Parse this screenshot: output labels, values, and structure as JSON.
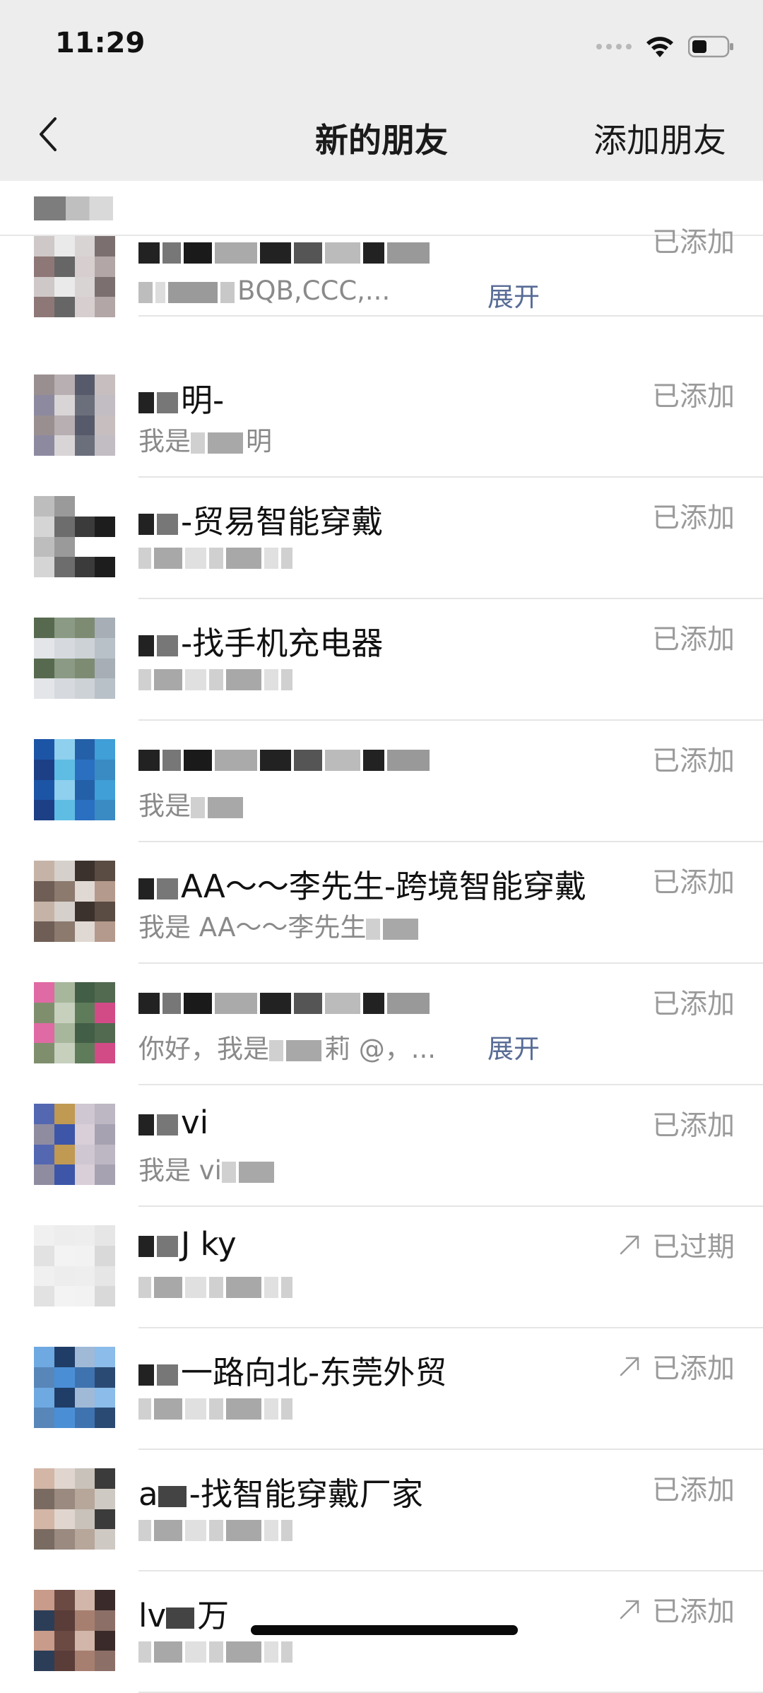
{
  "status_bar": {
    "time": "11:29"
  },
  "nav": {
    "back_icon": "chevron-left-icon",
    "title": "新的朋友",
    "right_action": "添加朋友"
  },
  "rows": [
    {
      "name": "",
      "message": "BQB,CCC,...",
      "expand": "展开",
      "status": "已添加",
      "arrow": false,
      "avatar": [
        "#cfc8c8",
        "#7b6f70",
        "#d7cfcf",
        "#eaeaea",
        "#8e7777",
        "#b3a6a7",
        "#d9d4d4",
        "#666"
      ]
    },
    {
      "name": "明-",
      "message": "我是",
      "message_tail": "明",
      "expand": "",
      "status": "已添加",
      "arrow": false,
      "avatar": [
        "#d9d4d6",
        "#9a8f90",
        "#c7bfbf",
        "#6b6f7c",
        "#b7afb2",
        "#8d8aa0",
        "#c2bdc2",
        "#575a6b"
      ]
    },
    {
      "name": "-贸易智能穿戴",
      "message": "",
      "expand": "",
      "status": "已添加",
      "arrow": false,
      "avatar": [
        "#ffffff",
        "#6d6d6d",
        "#bdbdbd",
        "#ffffff",
        "#3b3b3b",
        "#9a9a9a",
        "#d5d5d5",
        "#1d1d1d"
      ]
    },
    {
      "name": "-找手机充电器",
      "message": "",
      "expand": "",
      "status": "已添加",
      "arrow": false,
      "avatar": [
        "#b8c0c8",
        "#7e8b73",
        "#d6dade",
        "#576a4f",
        "#a7aeb5",
        "#cdd2d6",
        "#8b9a85",
        "#e3e5e8"
      ]
    },
    {
      "name": "",
      "message": "我是",
      "expand": "",
      "status": "已添加",
      "arrow": false,
      "avatar": [
        "#1c3f86",
        "#3a8ac4",
        "#2460a8",
        "#5fbde4",
        "#1d55a6",
        "#3f9fd6",
        "#2b6fc0",
        "#8fd0ee"
      ]
    },
    {
      "name": "AA～～李先生-跨境智能穿戴",
      "message": "我是 AA～～李先生",
      "expand": "",
      "status": "已添加",
      "arrow": false,
      "avatar": [
        "#d6d0cc",
        "#6e5e55",
        "#b49a8c",
        "#3b322d",
        "#8c7a6e",
        "#c6b3a7",
        "#5a4b43",
        "#e0d8d3"
      ]
    },
    {
      "name": "",
      "message": "你好，我是",
      "message_tail": "莉 @，...",
      "expand": "展开",
      "status": "已添加",
      "arrow": false,
      "avatar": [
        "#5e7c5a",
        "#a7b79c",
        "#7f8f6e",
        "#d24b87",
        "#435e47",
        "#c6d0bd",
        "#e06aa4",
        "#516a50"
      ]
    },
    {
      "name": "vi",
      "message": "我是 vi",
      "expand": "",
      "status": "已添加",
      "arrow": false,
      "avatar": [
        "#bdb6c3",
        "#d8cfd8",
        "#c09a52",
        "#8f8ca0",
        "#a7a2b2",
        "#cfc7d1",
        "#3d56a8",
        "#5467b1"
      ]
    },
    {
      "name": "J    ky",
      "message": "",
      "expand": "",
      "status": "已过期",
      "arrow": true,
      "avatar": [
        "#f0f0f0",
        "#e6e6e6",
        "#f2f2f2",
        "#ededed",
        "#e2e2e2",
        "#d9d9d9",
        "#eeeeee",
        "#f3f3f3"
      ]
    },
    {
      "name": "一路向北-东莞外贸",
      "message": "",
      "expand": "",
      "status": "已添加",
      "arrow": true,
      "avatar": [
        "#4a8fd6",
        "#6ea9e2",
        "#8bbcea",
        "#3f73b0",
        "#1f3d66",
        "#5886b8",
        "#2b4a73",
        "#9fb9d6"
      ]
    },
    {
      "name": "-找智能穿戴厂家",
      "name_prefix": "a",
      "message": "",
      "expand": "",
      "status": "已添加",
      "arrow": false,
      "avatar": [
        "#c8c2bb",
        "#9a8a80",
        "#d3b6a6",
        "#3b3b3b",
        "#b7a69a",
        "#e0d6cf",
        "#7a6b62",
        "#cfc9c4"
      ]
    },
    {
      "name": "万",
      "name_prefix": "lv",
      "message": "",
      "expand": "",
      "status": "已添加",
      "arrow": true,
      "avatar": [
        "#8c6f66",
        "#d1b6a9",
        "#5a3d38",
        "#c99b8a",
        "#3a2b2a",
        "#a77f70",
        "#6b4a44",
        "#2c3e57"
      ]
    }
  ]
}
